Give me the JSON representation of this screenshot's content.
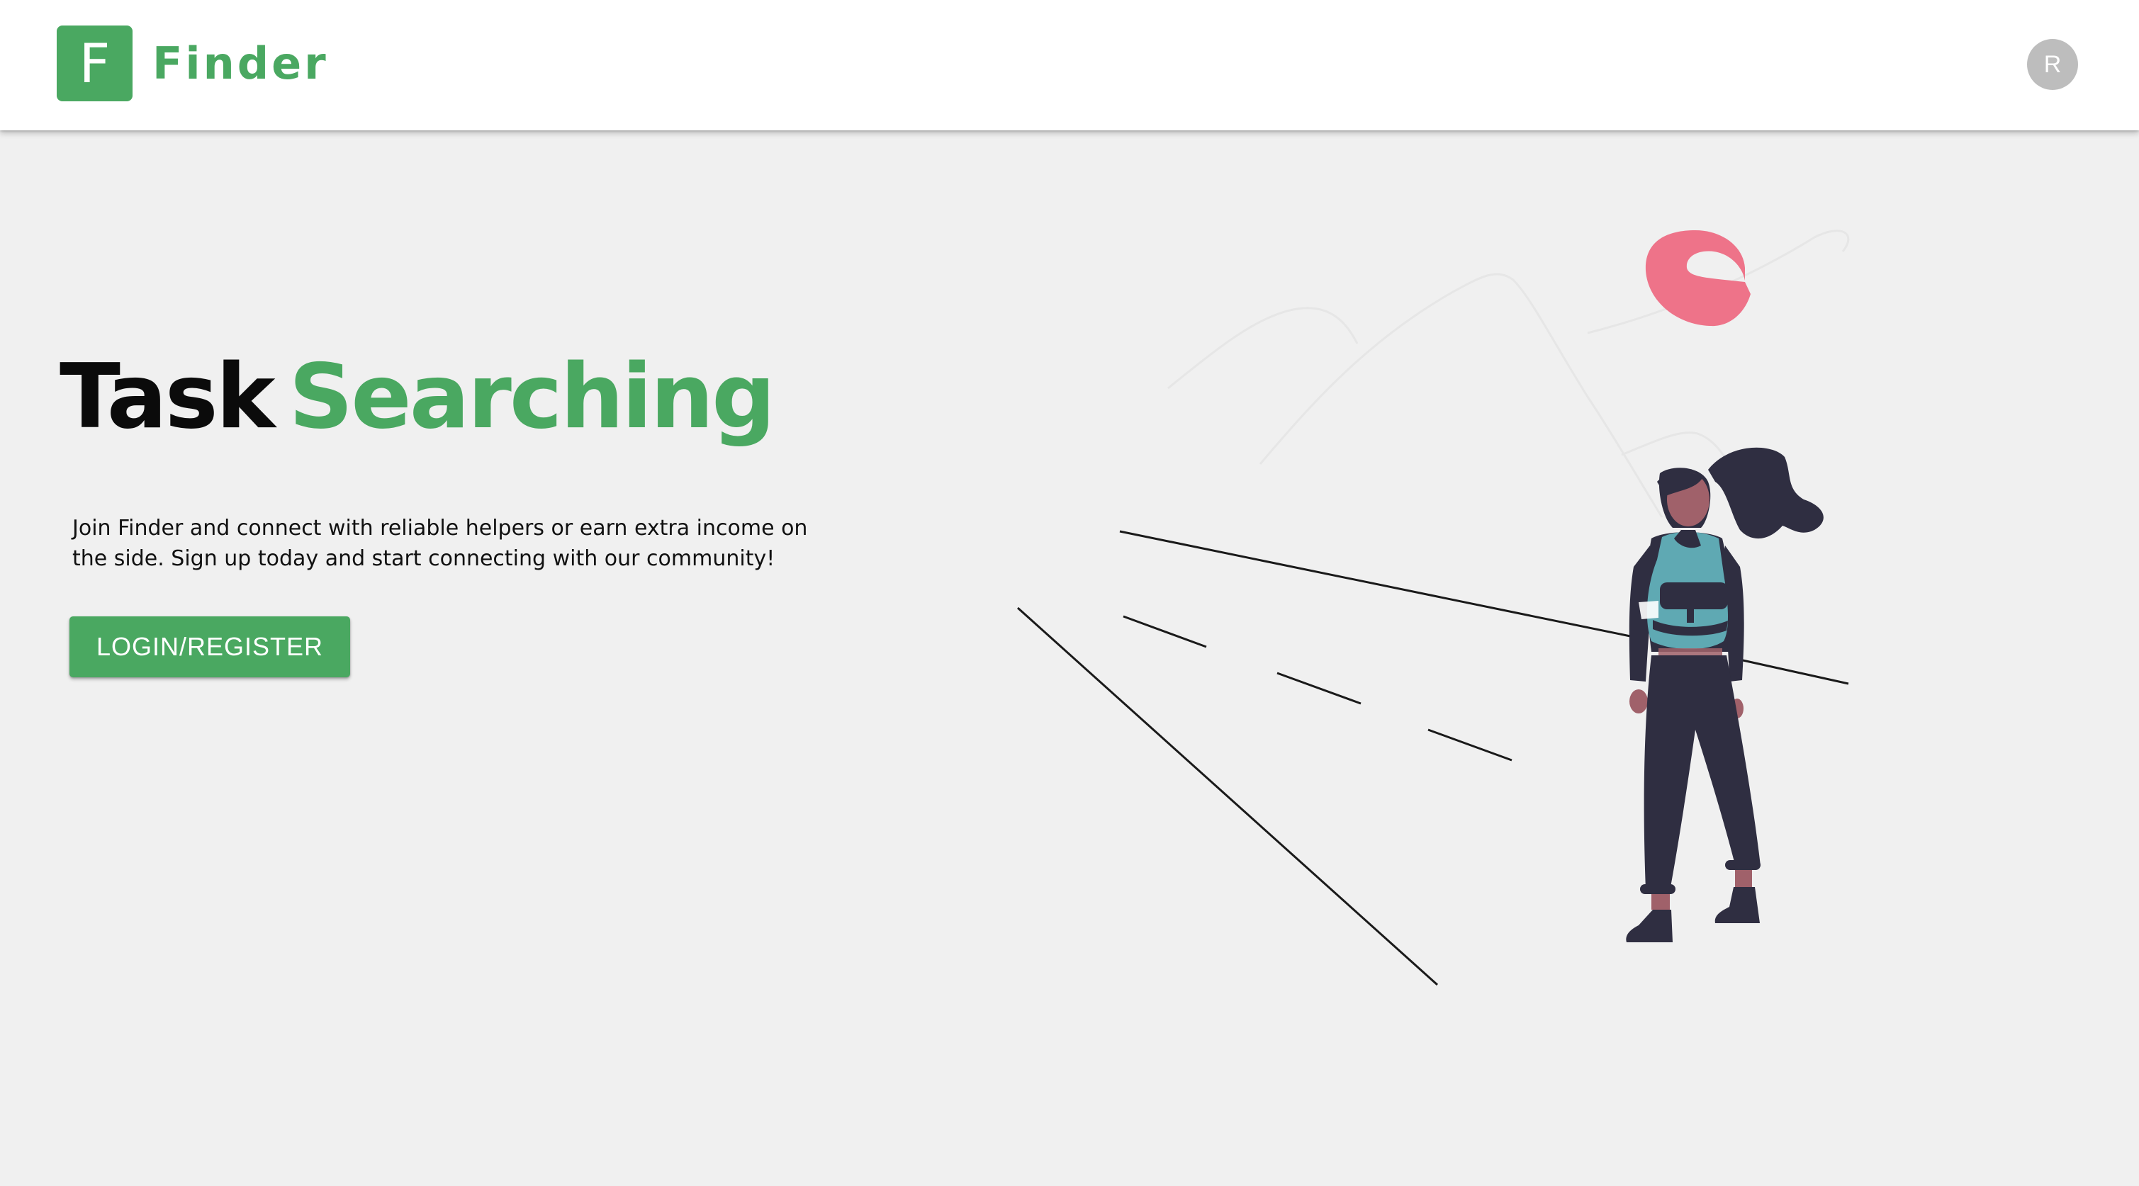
{
  "colors": {
    "brand_green": "#4aa861",
    "page_background": "#f0f0f0",
    "app_bar_background": "#ffffff",
    "title_dark": "#0b0b0b",
    "avatar_gray": "#bdbdbd",
    "illustration_dark": "#2f2e41",
    "illustration_teal": "#5fa9b3",
    "illustration_pink": "#ee7389"
  },
  "header": {
    "logo_letter": "F",
    "brand_name": "Finder",
    "avatar_initial": "R"
  },
  "hero": {
    "title_word_1": "Task",
    "title_word_2": "Searching",
    "description": "Join Finder and connect with reliable helpers or earn extra income on the side. Sign up today and start connecting with our community!",
    "cta_label": "LOGIN/REGISTER"
  },
  "illustration": {
    "subject": "woman-with-backpack-looking-at-mountains",
    "icons": [
      "sun-icon",
      "mountain-icon",
      "person-icon"
    ]
  }
}
